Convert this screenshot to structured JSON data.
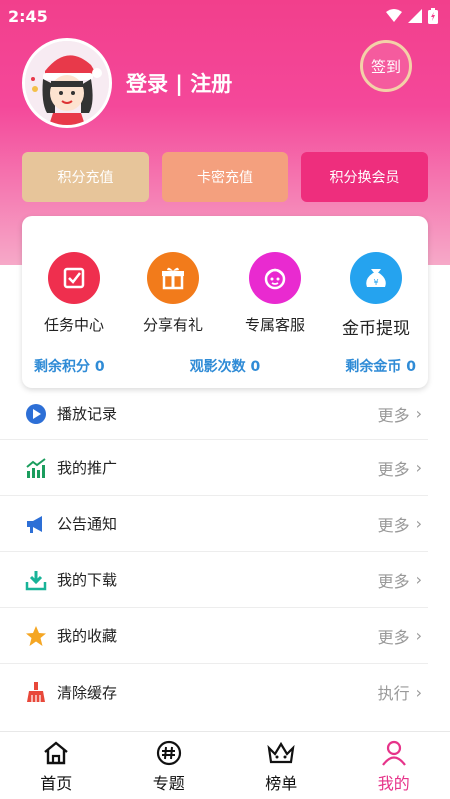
{
  "status_bar": {
    "time": "2:45"
  },
  "profile": {
    "login_text": "登录 | 注册",
    "signin_label": "签到"
  },
  "actions": [
    {
      "label": "积分充值"
    },
    {
      "label": "卡密充值"
    },
    {
      "label": "积分换会员"
    }
  ],
  "features": [
    {
      "label": "任务中心",
      "icon": "task-icon",
      "color": "#ef2f4e"
    },
    {
      "label": "分享有礼",
      "icon": "gift-icon",
      "color": "#f27b1b"
    },
    {
      "label": "专属客服",
      "icon": "support-icon",
      "color": "#e92ad0"
    },
    {
      "label": "金币提现",
      "icon": "money-bag-icon",
      "color": "#25a3ef"
    }
  ],
  "stats": [
    {
      "text": "剩余积分 0"
    },
    {
      "text": "观影次数 0"
    },
    {
      "text": "剩余金币 0"
    }
  ],
  "menu": [
    {
      "label": "播放记录",
      "action": "更多",
      "icon": "play-icon"
    },
    {
      "label": "我的推广",
      "action": "更多",
      "icon": "trend-icon"
    },
    {
      "label": "公告通知",
      "action": "更多",
      "icon": "megaphone-icon"
    },
    {
      "label": "我的下载",
      "action": "更多",
      "icon": "download-icon"
    },
    {
      "label": "我的收藏",
      "action": "更多",
      "icon": "star-icon"
    },
    {
      "label": "清除缓存",
      "action": "执行",
      "icon": "broom-icon"
    }
  ],
  "tabs": [
    {
      "label": "首页",
      "icon": "home-icon"
    },
    {
      "label": "专题",
      "icon": "topic-icon"
    },
    {
      "label": "榜单",
      "icon": "crown-icon"
    },
    {
      "label": "我的",
      "icon": "user-icon"
    }
  ],
  "colors": {
    "brand_pink": "#f23f8c",
    "stat_blue": "#2f8bd6",
    "active_tab": "#e6348a"
  }
}
